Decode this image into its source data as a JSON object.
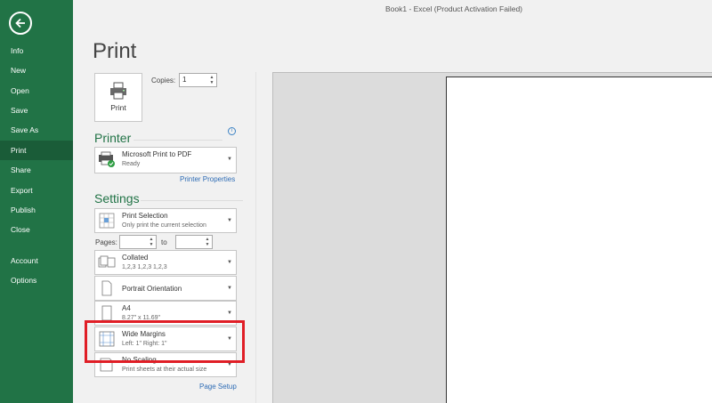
{
  "window": {
    "title": "Book1 - Excel (Product Activation Failed)"
  },
  "sidebar": {
    "items": [
      {
        "label": "Info"
      },
      {
        "label": "New"
      },
      {
        "label": "Open"
      },
      {
        "label": "Save"
      },
      {
        "label": "Save As"
      },
      {
        "label": "Print"
      },
      {
        "label": "Share"
      },
      {
        "label": "Export"
      },
      {
        "label": "Publish"
      },
      {
        "label": "Close"
      },
      {
        "label": "Account"
      },
      {
        "label": "Options"
      }
    ],
    "active": "Print",
    "color": "#217346"
  },
  "print": {
    "heading": "Print",
    "button_label": "Print",
    "copies_label": "Copies:",
    "copies_value": "1"
  },
  "printer": {
    "heading": "Printer",
    "name": "Microsoft Print to PDF",
    "status": "Ready",
    "properties_link": "Printer Properties"
  },
  "settings": {
    "heading": "Settings",
    "selection": {
      "main": "Print Selection",
      "sub": "Only print the current selection"
    },
    "pages_label": "Pages:",
    "to_label": "to",
    "collation": {
      "main": "Collated",
      "sub": "1,2,3    1,2,3    1,2,3"
    },
    "orientation": {
      "main": "Portrait Orientation"
    },
    "paper": {
      "main": "A4",
      "sub": "8.27\" x 11.69\""
    },
    "margins": {
      "main": "Wide Margins",
      "sub": "Left:  1\"    Right:  1\""
    },
    "scaling": {
      "main": "No Scaling",
      "sub": "Print sheets at their actual size"
    },
    "page_setup_link": "Page Setup"
  },
  "colors": {
    "accent": "#217346",
    "link": "#2e6cb5",
    "highlight": "#e01e26"
  }
}
